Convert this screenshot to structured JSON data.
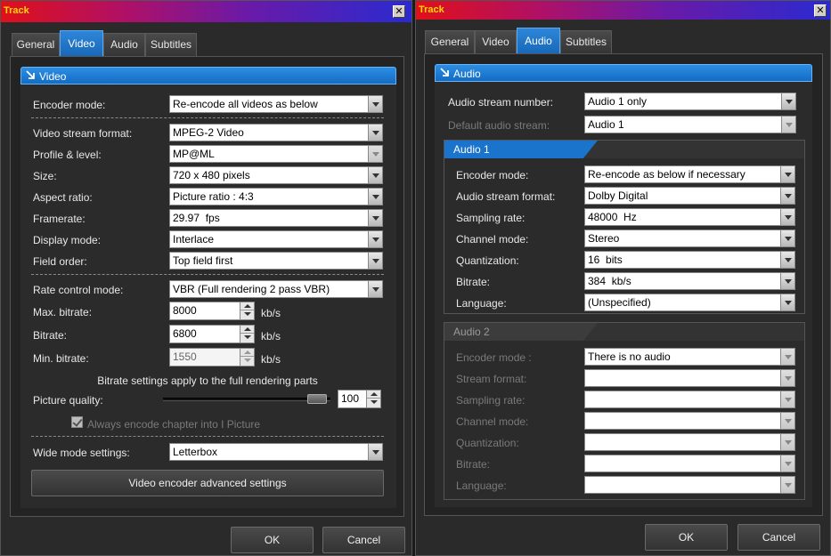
{
  "left": {
    "title": "Track",
    "close": "✕",
    "tabs": [
      "General",
      "Video",
      "Audio",
      "Subtitles"
    ],
    "active_tab": "Video",
    "section_title": "Video",
    "encoder_mode_label": "Encoder mode:",
    "encoder_mode_value": "Re-encode all videos as below",
    "stream_format_label": "Video stream format:",
    "stream_format_value": "MPEG-2 Video",
    "profile_label": "Profile & level:",
    "profile_value": "MP@ML",
    "size_label": "Size:",
    "size_value": "720 x 480 pixels",
    "aspect_label": "Aspect ratio:",
    "aspect_value": "Picture ratio : 4:3",
    "framerate_label": "Framerate:",
    "framerate_value": "29.97  fps",
    "display_label": "Display mode:",
    "display_value": "Interlace",
    "field_label": "Field order:",
    "field_value": "Top field first",
    "rate_label": "Rate control mode:",
    "rate_value": "VBR (Full rendering 2 pass VBR)",
    "max_bitrate_label": "Max. bitrate:",
    "max_bitrate_value": "8000",
    "bitrate_label": "Bitrate:",
    "bitrate_value": "6800",
    "min_bitrate_label": "Min. bitrate:",
    "min_bitrate_value": "1550",
    "unit": "kb/s",
    "bitrate_note": "Bitrate settings apply to the full rendering parts",
    "quality_label": "Picture quality:",
    "quality_value": "100",
    "chapter_label": "Always encode chapter into I Picture",
    "wide_label": "Wide mode settings:",
    "wide_value": "Letterbox",
    "advanced_btn": "Video encoder advanced settings",
    "ok": "OK",
    "cancel": "Cancel"
  },
  "right": {
    "title": "Track",
    "close": "✕",
    "tabs": [
      "General",
      "Video",
      "Audio",
      "Subtitles"
    ],
    "active_tab": "Audio",
    "section_title": "Audio",
    "stream_number_label": "Audio stream number:",
    "stream_number_value": "Audio 1 only",
    "default_stream_label": "Default audio stream:",
    "default_stream_value": "Audio 1",
    "audio1": {
      "title": "Audio 1",
      "encoder_label": "Encoder mode:",
      "encoder_value": "Re-encode as below if necessary",
      "format_label": "Audio stream format:",
      "format_value": "Dolby Digital",
      "sampling_label": "Sampling rate:",
      "sampling_value": "48000  Hz",
      "channel_label": "Channel mode:",
      "channel_value": "Stereo",
      "quant_label": "Quantization:",
      "quant_value": "16  bits",
      "bitrate_label": "Bitrate:",
      "bitrate_value": "384  kb/s",
      "language_label": "Language:",
      "language_value": "(Unspecified)"
    },
    "audio2": {
      "title": "Audio 2",
      "encoder_label": "Encoder mode :",
      "encoder_value": "There is no audio",
      "format_label": "Stream format:",
      "sampling_label": "Sampling rate:",
      "channel_label": "Channel mode:",
      "quant_label": "Quantization:",
      "bitrate_label": "Bitrate:",
      "language_label": "Language:"
    },
    "ok": "OK",
    "cancel": "Cancel"
  },
  "colors": {
    "accent": "#1e7ad0",
    "title_text": "#ffd800",
    "panel_bg": "#2b2b2b"
  }
}
